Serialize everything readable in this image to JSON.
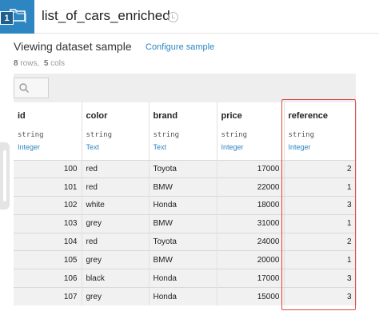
{
  "header": {
    "badge_number": "1",
    "dataset_name": "list_of_cars_enriched"
  },
  "subheader": {
    "title": "Viewing dataset sample",
    "configure_label": "Configure sample"
  },
  "counts": {
    "rows_value": "8",
    "rows_label": "rows,",
    "cols_value": "5",
    "cols_label": "cols"
  },
  "table": {
    "columns": [
      {
        "name": "id",
        "type": "string",
        "meaning": "Integer"
      },
      {
        "name": "color",
        "type": "string",
        "meaning": "Text"
      },
      {
        "name": "brand",
        "type": "string",
        "meaning": "Text"
      },
      {
        "name": "price",
        "type": "string",
        "meaning": "Integer"
      },
      {
        "name": "reference",
        "type": "string",
        "meaning": "Integer"
      }
    ],
    "rows": [
      [
        "100",
        "red",
        "Toyota",
        "17000",
        "2"
      ],
      [
        "101",
        "red",
        "BMW",
        "22000",
        "1"
      ],
      [
        "102",
        "white",
        "Honda",
        "18000",
        "3"
      ],
      [
        "103",
        "grey",
        "BMW",
        "31000",
        "1"
      ],
      [
        "104",
        "red",
        "Toyota",
        "24000",
        "2"
      ],
      [
        "105",
        "grey",
        "BMW",
        "20000",
        "1"
      ],
      [
        "106",
        "black",
        "Honda",
        "17000",
        "3"
      ],
      [
        "107",
        "grey",
        "Honda",
        "15000",
        "3"
      ]
    ]
  },
  "colors": {
    "accent": "#2d86c2",
    "highlight": "#e0493e"
  },
  "icons": {
    "dataset": "dataset-folder-icon",
    "history": "clock-icon",
    "search": "search-icon"
  }
}
